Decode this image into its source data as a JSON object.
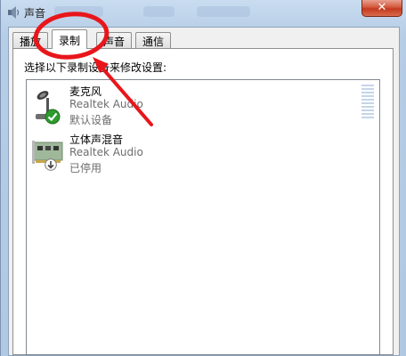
{
  "window": {
    "title": "声音",
    "title_icon": "speaker-icon",
    "close_label": "✕"
  },
  "tabs": [
    {
      "label": "播放",
      "active": false
    },
    {
      "label": "录制",
      "active": true
    },
    {
      "label": "声音",
      "active": false
    },
    {
      "label": "通信",
      "active": false
    }
  ],
  "panel": {
    "instruction": "选择以下录制设备来修改设置:"
  },
  "devices": [
    {
      "name": "麦克风",
      "driver": "Realtek Audio",
      "status": "默认设备",
      "icon": "microphone-icon",
      "badge": "default-check-icon"
    },
    {
      "name": "立体声混音",
      "driver": "Realtek Audio",
      "status": "已停用",
      "icon": "sound-card-icon",
      "badge": "disabled-arrow-icon"
    }
  ],
  "colors": {
    "annotation_red": "#e8161b",
    "close_red": "#c43a1f",
    "check_green": "#2e9b2e"
  }
}
